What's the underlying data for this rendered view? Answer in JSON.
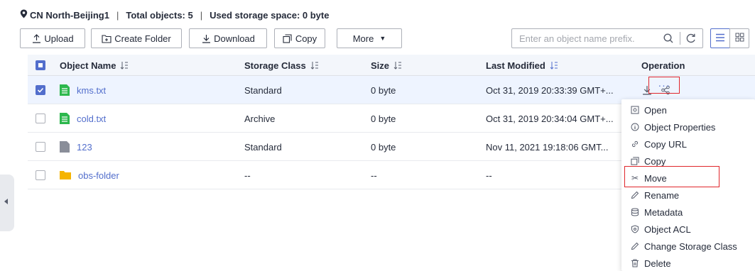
{
  "infobar": {
    "region": "CN North-Beijing1",
    "total_objects": "Total objects: 5",
    "used_storage": "Used storage space: 0 byte",
    "separator": "|"
  },
  "toolbar": {
    "upload": "Upload",
    "create_folder": "Create Folder",
    "download": "Download",
    "copy": "Copy",
    "more": "More"
  },
  "search": {
    "placeholder": "Enter an object name prefix."
  },
  "table": {
    "headers": {
      "name": "Object Name",
      "storage_class": "Storage Class",
      "size": "Size",
      "last_modified": "Last Modified",
      "operation": "Operation"
    },
    "rows": [
      {
        "name": "kms.txt",
        "storage_class": "Standard",
        "size": "0 byte",
        "last_modified": "Oct 31, 2019 20:33:39 GMT+...",
        "type": "file",
        "checked": true
      },
      {
        "name": "cold.txt",
        "storage_class": "Archive",
        "size": "0 byte",
        "last_modified": "Oct 31, 2019 20:34:04 GMT+...",
        "type": "file",
        "checked": false
      },
      {
        "name": "123",
        "storage_class": "Standard",
        "size": "0 byte",
        "last_modified": "Nov 11, 2021 19:18:06 GMT...",
        "type": "file-gray",
        "checked": false
      },
      {
        "name": "obs-folder",
        "storage_class": "--",
        "size": "--",
        "last_modified": "--",
        "type": "folder",
        "checked": false
      }
    ]
  },
  "operation_more": "···",
  "menu": {
    "items": [
      {
        "label": "Open",
        "icon": "open-icon"
      },
      {
        "label": "Object Properties",
        "icon": "info-icon"
      },
      {
        "label": "Copy URL",
        "icon": "link-icon"
      },
      {
        "label": "Copy",
        "icon": "copy-icon"
      },
      {
        "label": "Move",
        "icon": "scissors-icon"
      },
      {
        "label": "Rename",
        "icon": "pencil-icon"
      },
      {
        "label": "Metadata",
        "icon": "database-icon"
      },
      {
        "label": "Object ACL",
        "icon": "shield-icon"
      },
      {
        "label": "Change Storage Class",
        "icon": "pencil-icon"
      },
      {
        "label": "Delete",
        "icon": "trash-icon"
      }
    ]
  },
  "colors": {
    "accent": "#526ecc",
    "highlight_border": "#e0262b",
    "file_icon": "#2db84d",
    "folder_icon": "#f5b400",
    "header_bg": "#f3f6fb"
  }
}
